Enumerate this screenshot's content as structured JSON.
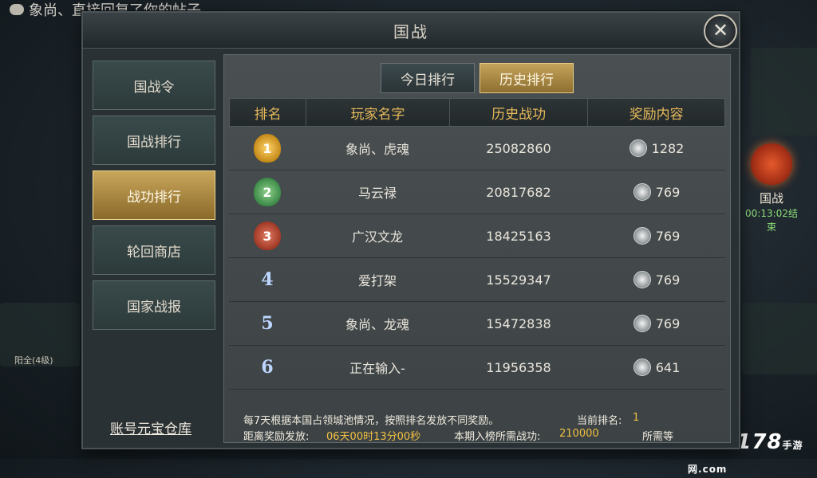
{
  "chat": {
    "text": "象尚、直接回复了你的帖子"
  },
  "dialog": {
    "title": "国战",
    "close": "✕"
  },
  "menu": {
    "items": [
      {
        "label": "国战令"
      },
      {
        "label": "国战排行"
      },
      {
        "label": "战功排行",
        "active": true
      },
      {
        "label": "轮回商店"
      },
      {
        "label": "国家战报"
      }
    ],
    "footer_link": "账号元宝仓库"
  },
  "tabs": {
    "today": "今日排行",
    "history": "历史排行",
    "active": "history"
  },
  "table": {
    "headers": {
      "rank": "排名",
      "player": "玩家名字",
      "merit": "历史战功",
      "reward": "奖励内容"
    },
    "rows": [
      {
        "rank": "1",
        "player": "象尚、虎魂",
        "merit": "25082860",
        "reward": "1282"
      },
      {
        "rank": "2",
        "player": "马云禄",
        "merit": "20817682",
        "reward": "769"
      },
      {
        "rank": "3",
        "player": "广汉文龙",
        "merit": "18425163",
        "reward": "769"
      },
      {
        "rank": "4",
        "player": "爱打架",
        "merit": "15529347",
        "reward": "769"
      },
      {
        "rank": "5",
        "player": "象尚、龙魂",
        "merit": "15472838",
        "reward": "769"
      },
      {
        "rank": "6",
        "player": "正在输入-",
        "merit": "11956358",
        "reward": "641"
      }
    ]
  },
  "info": {
    "rule": "每7天根据本国占领城池情况，按照排名发放不同奖励。",
    "current_rank_label": "当前排名:",
    "current_rank_value": "1",
    "countdown_label": "距离奖励发放:",
    "countdown_value": "06天00时13分00秒",
    "threshold_label": "本期入榜所需战功:",
    "threshold_value": "210000",
    "need_label": "所需等"
  },
  "side": {
    "label": "国战",
    "timer": "00:13:02结束"
  },
  "watermark": {
    "main": "APP178",
    "sub": "手游网",
    "domain": ".com"
  },
  "map": {
    "city_label": "阳全(4级)"
  },
  "colors": {
    "gold_header": "#e6b95a",
    "active_gold": "#c4a35a",
    "yellow_text": "#f0c040"
  }
}
